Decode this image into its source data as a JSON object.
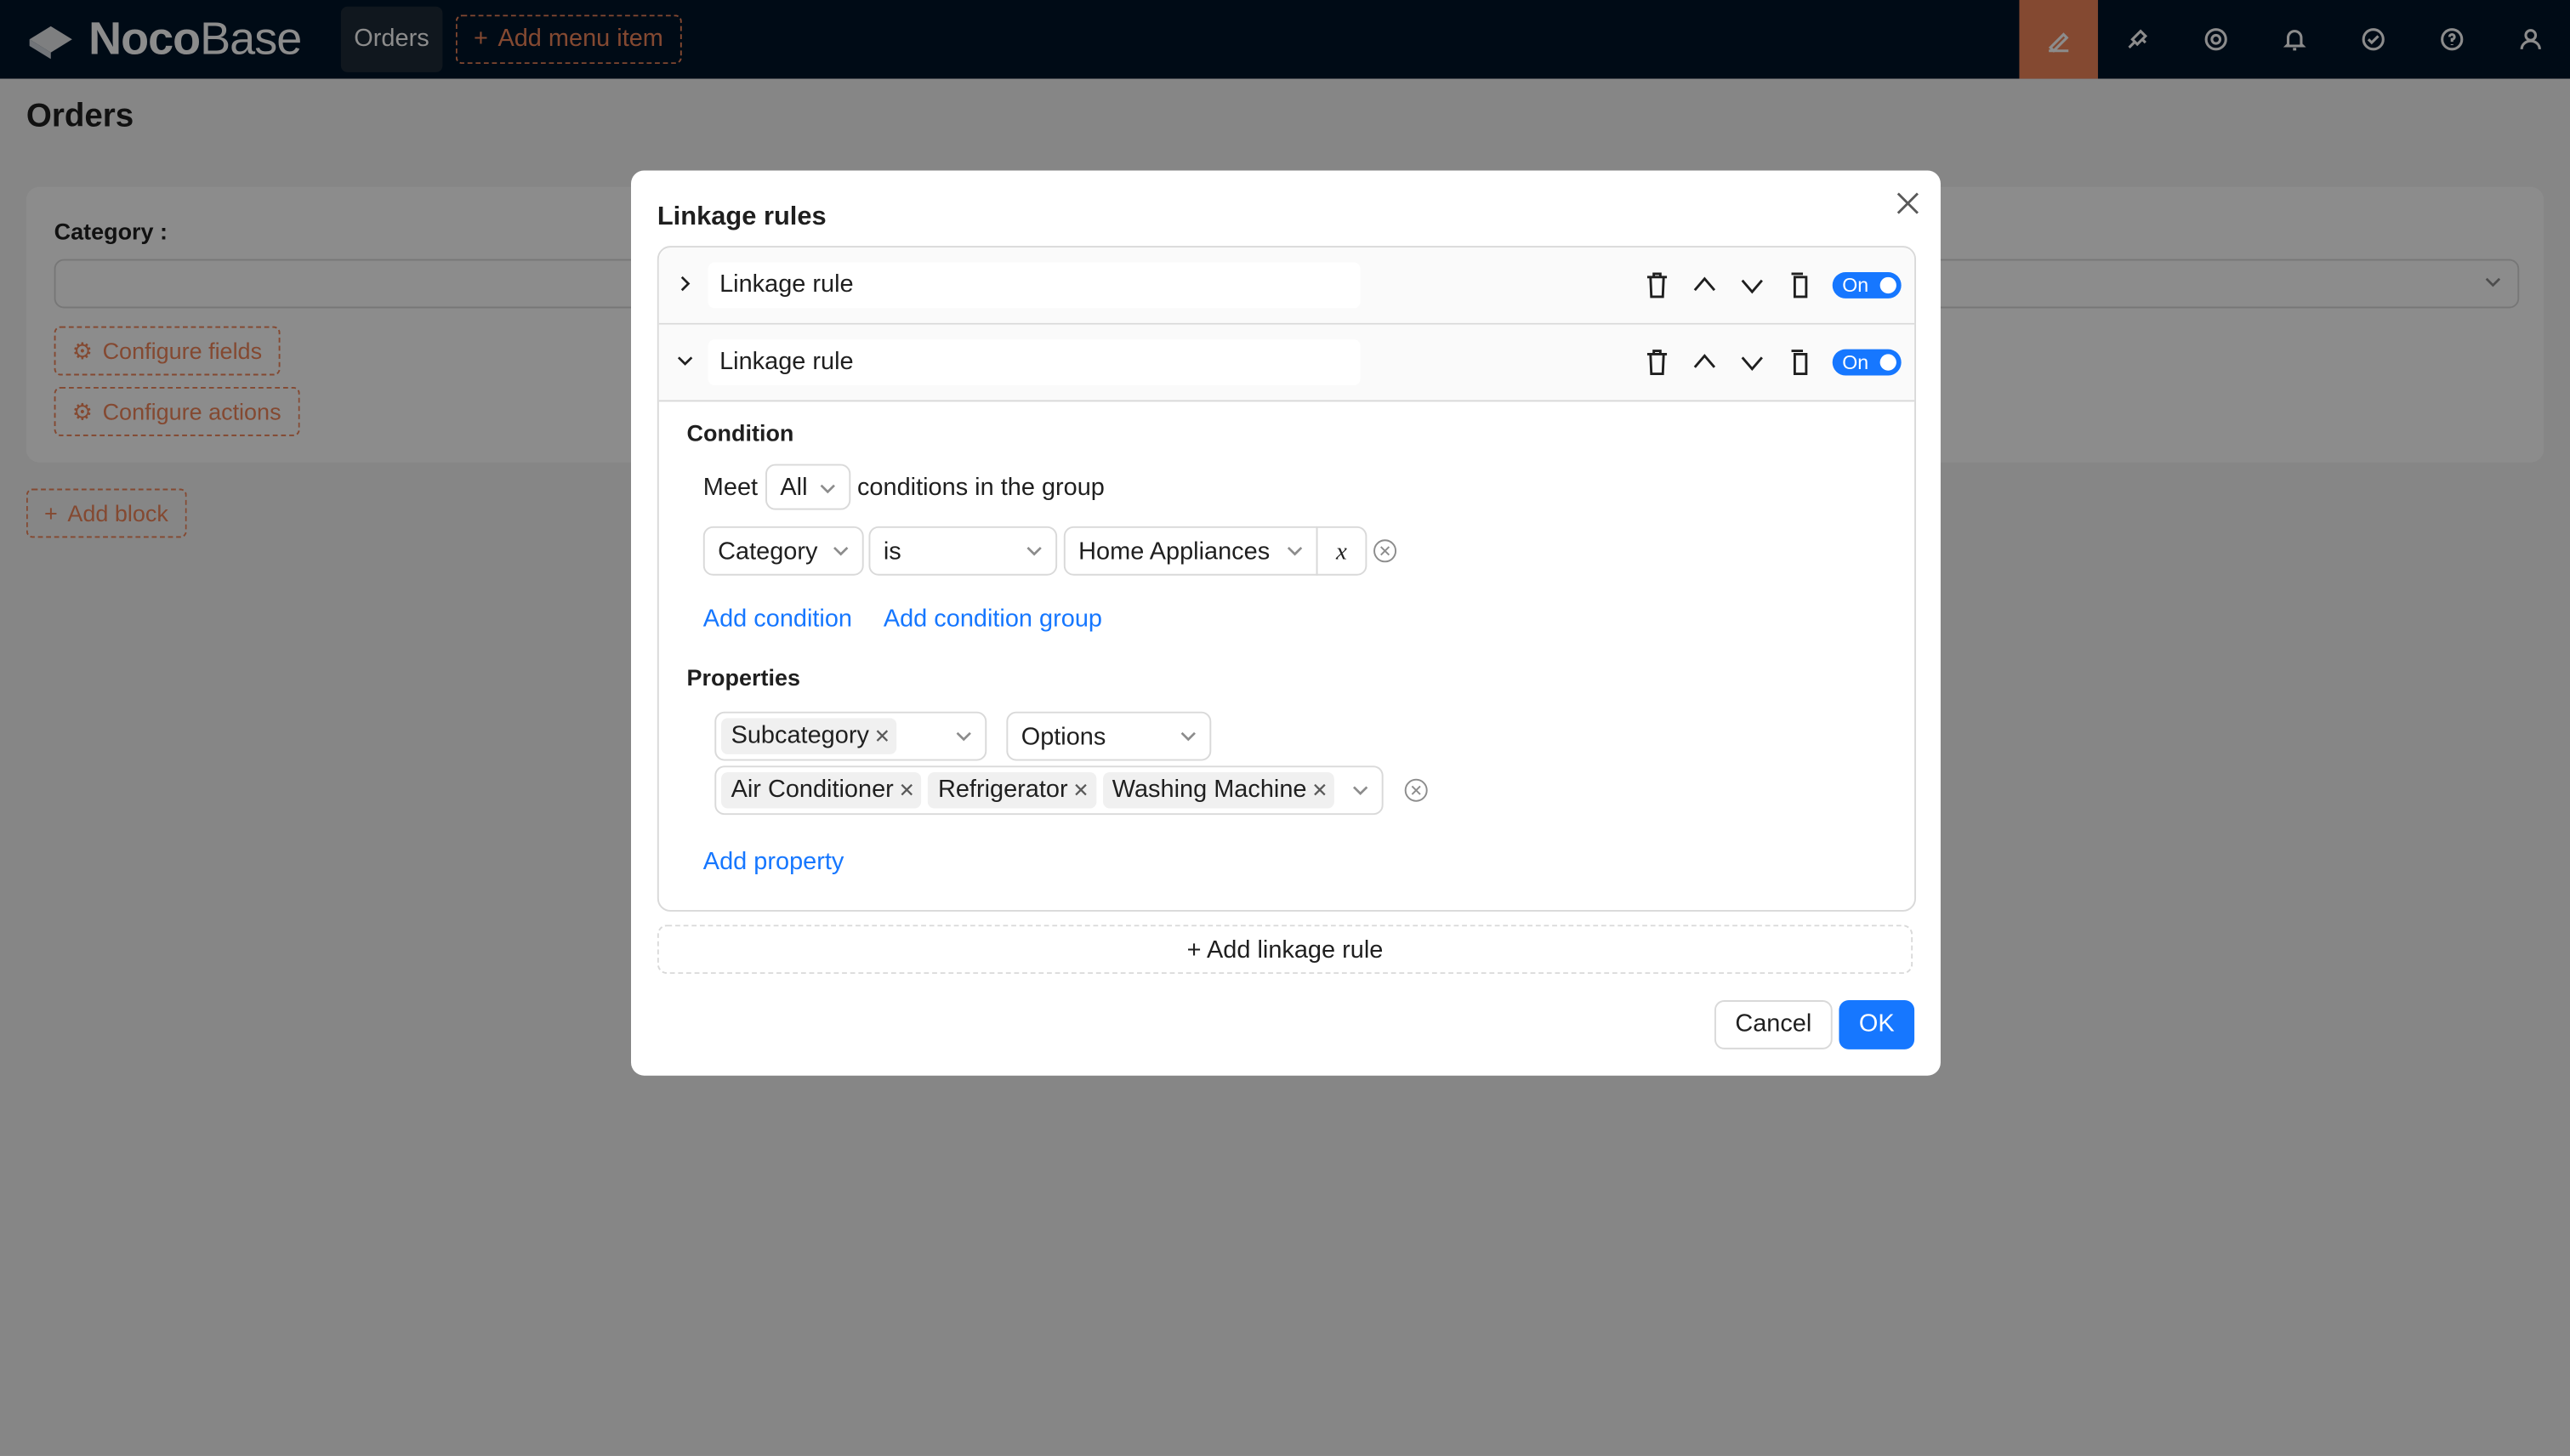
{
  "app": {
    "logo_bold": "Noco",
    "logo_light": "Base"
  },
  "topbar": {
    "menu_tab": "Orders",
    "add_menu_item": "Add menu item",
    "icons": [
      "ui-editor-icon",
      "plugin-icon",
      "settings-icon",
      "notification-icon",
      "tasks-icon",
      "help-icon",
      "user-icon"
    ],
    "accent": "#f0855a"
  },
  "page": {
    "title": "Orders",
    "filter_label": "Category :",
    "configure_fields": "Configure fields",
    "configure_actions": "Configure actions",
    "add_block": "Add block"
  },
  "modal": {
    "title": "Linkage rules",
    "rules": [
      {
        "name": "Linkage rule",
        "expanded": false,
        "toggle": "On"
      },
      {
        "name": "Linkage rule",
        "expanded": true,
        "toggle": "On"
      }
    ],
    "condition": {
      "title": "Condition",
      "meet_prefix": "Meet",
      "meet_value": "All",
      "meet_suffix": "conditions in the group",
      "field": "Category",
      "operator": "is",
      "value": "Home Appliances",
      "variable_symbol": "x",
      "add_condition": "Add condition",
      "add_condition_group": "Add condition group"
    },
    "properties": {
      "title": "Properties",
      "field_tag": "Subcategory",
      "property": "Options",
      "options": [
        "Air Conditioner",
        "Refrigerator",
        "Washing Machine"
      ],
      "add_property": "Add property"
    },
    "add_linkage_rule": "Add linkage rule",
    "cancel": "Cancel",
    "ok": "OK",
    "primary_color": "#1677ff"
  }
}
